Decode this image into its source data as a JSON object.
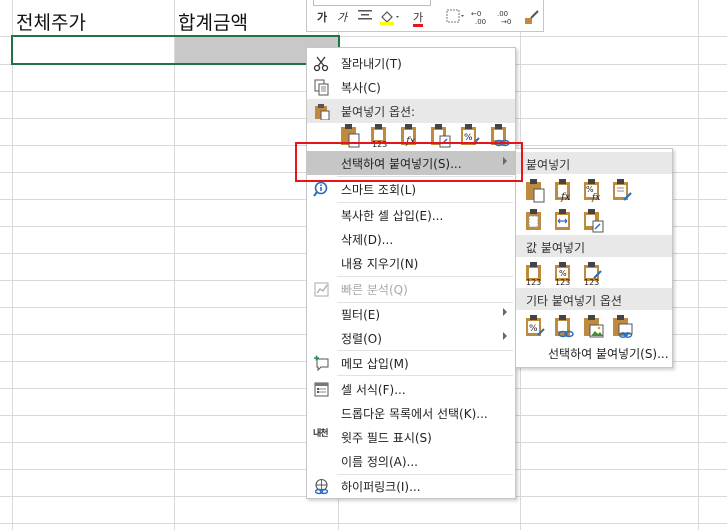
{
  "cells": {
    "a_header": "전체주가",
    "b_header": "합계금액"
  },
  "mini_toolbar": {
    "bold_label": "가",
    "italic_label": "가",
    "font_color_label": "가"
  },
  "context_menu": {
    "items": [
      {
        "label": "잘라내기(T)",
        "icon": "scissors-icon"
      },
      {
        "label": "복사(C)",
        "icon": "copy-icon"
      },
      {
        "label": "붙여넣기 옵션:",
        "icon": "paste-icon"
      },
      {
        "label": "선택하여 붙여넣기(S)...",
        "icon": ""
      },
      {
        "label": "스마트 조회(L)",
        "icon": "smart-lookup-icon"
      },
      {
        "label": "복사한 셀 삽입(E)...",
        "icon": ""
      },
      {
        "label": "삭제(D)...",
        "icon": ""
      },
      {
        "label": "내용 지우기(N)",
        "icon": ""
      },
      {
        "label": "빠른 분석(Q)",
        "icon": "quick-analysis-icon"
      },
      {
        "label": "필터(E)",
        "icon": ""
      },
      {
        "label": "정렬(O)",
        "icon": ""
      },
      {
        "label": "메모 삽입(M)",
        "icon": "comment-icon"
      },
      {
        "label": "셀 서식(F)...",
        "icon": "format-cells-icon"
      },
      {
        "label": "드롭다운 목록에서 선택(K)...",
        "icon": ""
      },
      {
        "label": "윗주 필드 표시(S)",
        "icon": "phonetic-icon"
      },
      {
        "label": "이름 정의(A)...",
        "icon": ""
      },
      {
        "label": "하이퍼링크(I)...",
        "icon": "hyperlink-icon"
      }
    ],
    "phonetic_icon_text": "내천",
    "paste_badges": [
      "123",
      "fx",
      "%"
    ]
  },
  "submenu": {
    "sections": [
      "붙여넣기",
      "값 붙여넣기",
      "기타 붙여넣기 옵션"
    ],
    "link": "선택하여 붙여넣기(S)...",
    "badge_123": "123",
    "badge_fx": "fx",
    "badge_pct": "%"
  },
  "colors": {
    "accent_green": "#217346",
    "highlight": "#c6c6c6",
    "annotation_red": "#e8141c",
    "clipboard": "#c08a3e"
  }
}
